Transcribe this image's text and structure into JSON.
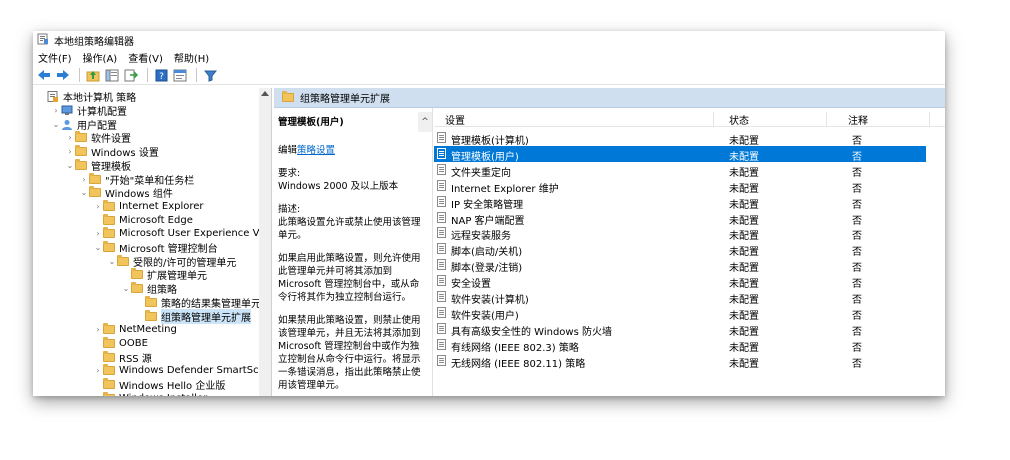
{
  "window": {
    "title": "本地组策略编辑器"
  },
  "menu": [
    "文件(F)",
    "操作(A)",
    "查看(V)",
    "帮助(H)"
  ],
  "toolbar": [
    "back-icon",
    "forward-icon",
    "up-folder-icon",
    "show-tree-icon",
    "export-icon",
    "help-icon",
    "properties-icon",
    "filter-icon"
  ],
  "tree": [
    {
      "label": "本地计算机 策略",
      "expander": "",
      "icon": "policy-icon"
    },
    {
      "label": "计算机配置",
      "expander": ">",
      "icon": "computer-icon"
    },
    {
      "label": "用户配置",
      "expander": "v",
      "icon": "user-icon"
    },
    {
      "label": "软件设置",
      "expander": ">",
      "icon": "folder-icon"
    },
    {
      "label": "Windows 设置",
      "expander": ">",
      "icon": "folder-icon"
    },
    {
      "label": "管理模板",
      "expander": "v",
      "icon": "folder-icon"
    },
    {
      "label": "\"开始\"菜单和任务栏",
      "expander": ">",
      "icon": "folder-icon"
    },
    {
      "label": "Windows 组件",
      "expander": "v",
      "icon": "folder-icon"
    },
    {
      "label": "Internet Explorer",
      "expander": ">",
      "icon": "folder-icon"
    },
    {
      "label": "Microsoft Edge",
      "expander": "",
      "icon": "folder-icon"
    },
    {
      "label": "Microsoft User Experience Virtualiza",
      "expander": ">",
      "icon": "folder-icon"
    },
    {
      "label": "Microsoft 管理控制台",
      "expander": "v",
      "icon": "folder-icon"
    },
    {
      "label": "受限的/许可的管理单元",
      "expander": "v",
      "icon": "folder-icon"
    },
    {
      "label": "扩展管理单元",
      "expander": "",
      "icon": "folder-icon"
    },
    {
      "label": "组策略",
      "expander": "v",
      "icon": "folder-icon"
    },
    {
      "label": "策略的结果集管理单元扩展",
      "expander": "",
      "icon": "folder-icon"
    },
    {
      "label": "组策略管理单元扩展",
      "expander": "",
      "icon": "folder-icon"
    },
    {
      "label": "NetMeeting",
      "expander": ">",
      "icon": "folder-icon"
    },
    {
      "label": "OOBE",
      "expander": "",
      "icon": "folder-icon"
    },
    {
      "label": "RSS 源",
      "expander": "",
      "icon": "folder-icon"
    },
    {
      "label": "Windows Defender SmartScreen",
      "expander": ">",
      "icon": "folder-icon"
    },
    {
      "label": "Windows Hello 企业版",
      "expander": "",
      "icon": "folder-icon"
    },
    {
      "label": "Windows Installer",
      "expander": "",
      "icon": "folder-icon"
    }
  ],
  "header": {
    "title": "组策略管理单元扩展"
  },
  "description": {
    "title": "管理模板(用户)",
    "edit_prefix": "编辑",
    "edit_link": "策略设置",
    "requirements_label": "要求:",
    "requirements_text": "Windows 2000 及以上版本",
    "desc_label": "描述:",
    "desc_text": "此策略设置允许或禁止使用该管理单元。",
    "para_enabled": "如果启用此策略设置，则允许使用此管理单元并可将其添加到 Microsoft 管理控制台中，或从命令行将其作为独立控制台运行。",
    "para_disabled": "如果禁用此策略设置，则禁止使用该管理单元，并且无法将其添加到 Microsoft 管理控制台中或作为独立控制台从命令行中运行。将显示一条错误消息，指出此策略禁止使用该管理单元。"
  },
  "list": {
    "columns": {
      "setting": "设置",
      "state": "状态",
      "comment": "注释"
    },
    "rows": [
      {
        "name": "管理模板(计算机)",
        "state": "未配置",
        "comment": "否"
      },
      {
        "name": "管理模板(用户)",
        "state": "未配置",
        "comment": "否"
      },
      {
        "name": "文件夹重定向",
        "state": "未配置",
        "comment": "否"
      },
      {
        "name": "Internet Explorer 维护",
        "state": "未配置",
        "comment": "否"
      },
      {
        "name": "IP 安全策略管理",
        "state": "未配置",
        "comment": "否"
      },
      {
        "name": "NAP 客户端配置",
        "state": "未配置",
        "comment": "否"
      },
      {
        "name": "远程安装服务",
        "state": "未配置",
        "comment": "否"
      },
      {
        "name": "脚本(启动/关机)",
        "state": "未配置",
        "comment": "否"
      },
      {
        "name": "脚本(登录/注销)",
        "state": "未配置",
        "comment": "否"
      },
      {
        "name": "安全设置",
        "state": "未配置",
        "comment": "否"
      },
      {
        "name": "软件安装(计算机)",
        "state": "未配置",
        "comment": "否"
      },
      {
        "name": "软件安装(用户)",
        "state": "未配置",
        "comment": "否"
      },
      {
        "name": "具有高级安全性的 Windows 防火墙",
        "state": "未配置",
        "comment": "否"
      },
      {
        "name": "有线网络 (IEEE 802.3) 策略",
        "state": "未配置",
        "comment": "否"
      },
      {
        "name": "无线网络 (IEEE 802.11) 策略",
        "state": "未配置",
        "comment": "否"
      }
    ],
    "selected_index": 1
  },
  "colors": {
    "selection": "#0078d7",
    "header_band": "#cfdff0",
    "tree_selection": "#cce4f7",
    "link": "#0066cc"
  }
}
